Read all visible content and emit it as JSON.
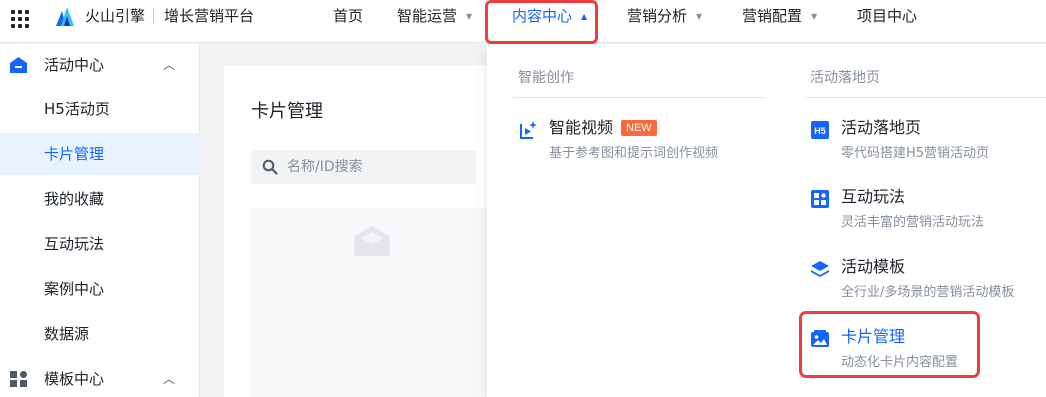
{
  "brand": {
    "name": "火山引擎",
    "platform": "增长营销平台"
  },
  "nav": {
    "items": [
      {
        "label": "首页",
        "has_caret": false
      },
      {
        "label": "智能运营",
        "has_caret": true
      },
      {
        "label": "内容中心",
        "has_caret": true,
        "active": true
      },
      {
        "label": "营销分析",
        "has_caret": true
      },
      {
        "label": "营销配置",
        "has_caret": true
      },
      {
        "label": "项目中心",
        "has_caret": false
      }
    ],
    "caret_down": "▼",
    "caret_up": "▲"
  },
  "sidebar": {
    "groups": [
      {
        "label": "活动中心",
        "icon": "home-icon",
        "chevron": "︿"
      },
      {
        "label": "模板中心",
        "icon": "template-icon",
        "chevron": "︿"
      }
    ],
    "items": [
      {
        "label": "H5活动页"
      },
      {
        "label": "卡片管理",
        "active": true
      },
      {
        "label": "我的收藏"
      },
      {
        "label": "互动玩法"
      },
      {
        "label": "案例中心"
      },
      {
        "label": "数据源"
      }
    ]
  },
  "main": {
    "title": "卡片管理",
    "search_placeholder": "名称/ID搜索"
  },
  "dropdown": {
    "left_column": {
      "title": "智能创作",
      "items": [
        {
          "title": "智能视频",
          "badge": "NEW",
          "desc": "基于参考图和提示词创作视频",
          "icon": "video-icon"
        }
      ]
    },
    "right_column": {
      "title": "活动落地页",
      "items": [
        {
          "title": "活动落地页",
          "desc": "零代码搭建H5营销活动页",
          "icon": "h5-icon"
        },
        {
          "title": "互动玩法",
          "desc": "灵活丰富的营销活动玩法",
          "icon": "interactive-icon"
        },
        {
          "title": "活动模板",
          "desc": "全行业/多场景的营销活动模板",
          "icon": "layers-icon"
        },
        {
          "title": "卡片管理",
          "desc": "动态化卡片内容配置",
          "icon": "image-card-icon",
          "active": true
        }
      ]
    }
  },
  "colors": {
    "primary": "#1664ff",
    "highlight": "#f03e3e",
    "badge": "#f76b3b"
  }
}
